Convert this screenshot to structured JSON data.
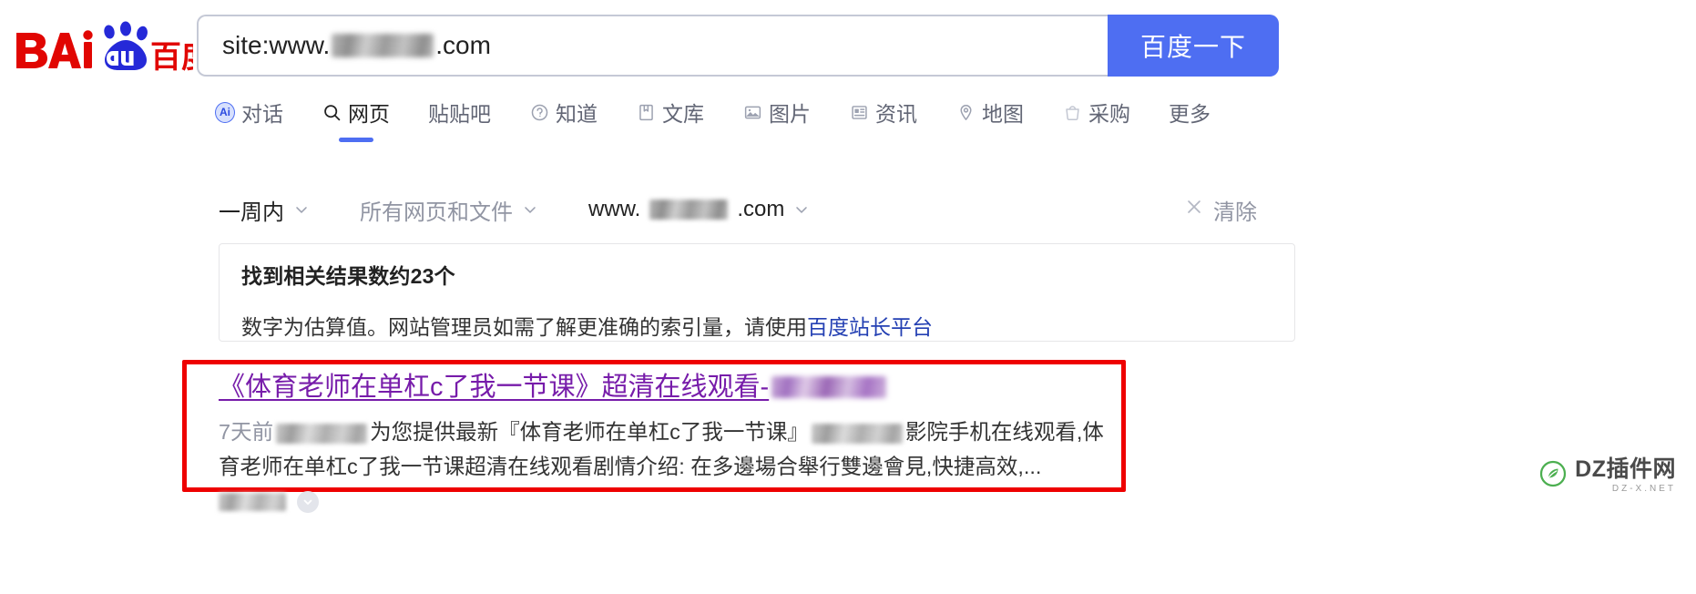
{
  "brand": {
    "logo_text_latin": "Bai",
    "logo_text_cn": "百度",
    "logo_paw_label": "du",
    "red": "#e10602",
    "blue": "#2529d8"
  },
  "search": {
    "query_prefix": "site:www.",
    "query_suffix": ".com",
    "redacted": true,
    "clear_icon": "close-icon",
    "voice_icon": "microphone-icon",
    "camera_icon": "camera-icon",
    "button_label": "百度一下",
    "button_color": "#4e6ef2"
  },
  "nav": {
    "tabs": [
      {
        "label": "对话",
        "icon": "ai-badge-icon",
        "active": false
      },
      {
        "label": "网页",
        "icon": "search-icon",
        "active": true
      },
      {
        "label": "贴贴吧",
        "icon": "none",
        "active": false
      },
      {
        "label": "知道",
        "icon": "question-circle-icon",
        "active": false
      },
      {
        "label": "文库",
        "icon": "book-icon",
        "active": false
      },
      {
        "label": "图片",
        "icon": "image-icon",
        "active": false
      },
      {
        "label": "资讯",
        "icon": "news-icon",
        "active": false
      },
      {
        "label": "地图",
        "icon": "map-pin-icon",
        "active": false
      },
      {
        "label": "采购",
        "icon": "shopping-bag-icon",
        "active": false
      },
      {
        "label": "更多",
        "icon": "none",
        "active": false
      }
    ]
  },
  "filters": {
    "time": "一周内",
    "type": "所有网页和文件",
    "site_prefix": "www.",
    "site_suffix": ".com",
    "clear_label": "清除",
    "clear_icon": "close-icon",
    "chevron_icon": "chevron-down-icon"
  },
  "info_box": {
    "result_count_text": "找到相关结果数约23个",
    "count": 23,
    "note_before_link": "数字为估算值。网站管理员如需了解更准确的索引量，请使用",
    "link_label": "百度站长平台",
    "link_color": "#2440b3"
  },
  "result": {
    "title": "《体育老师在单杠c了我一节课》超清在线观看-",
    "title_color": "#771caa",
    "date": "7天前",
    "snippet_part1": "为您提供最新『体育老师在单杠c了我一节课』",
    "snippet_part2": "影院手机在线观看,体育老师在单杠c了我一节课超清在线观看剧情介绍: 在多邊場合舉行雙邊會見,快捷高效,...",
    "highlight_border_color": "#ee0000",
    "expand_icon": "chevron-down-circle-icon"
  },
  "watermark": {
    "main": "DZ插件网",
    "sub": "DZ-X.NET",
    "mark_icon": "leaf-circle-icon",
    "color": "#4caf50"
  }
}
